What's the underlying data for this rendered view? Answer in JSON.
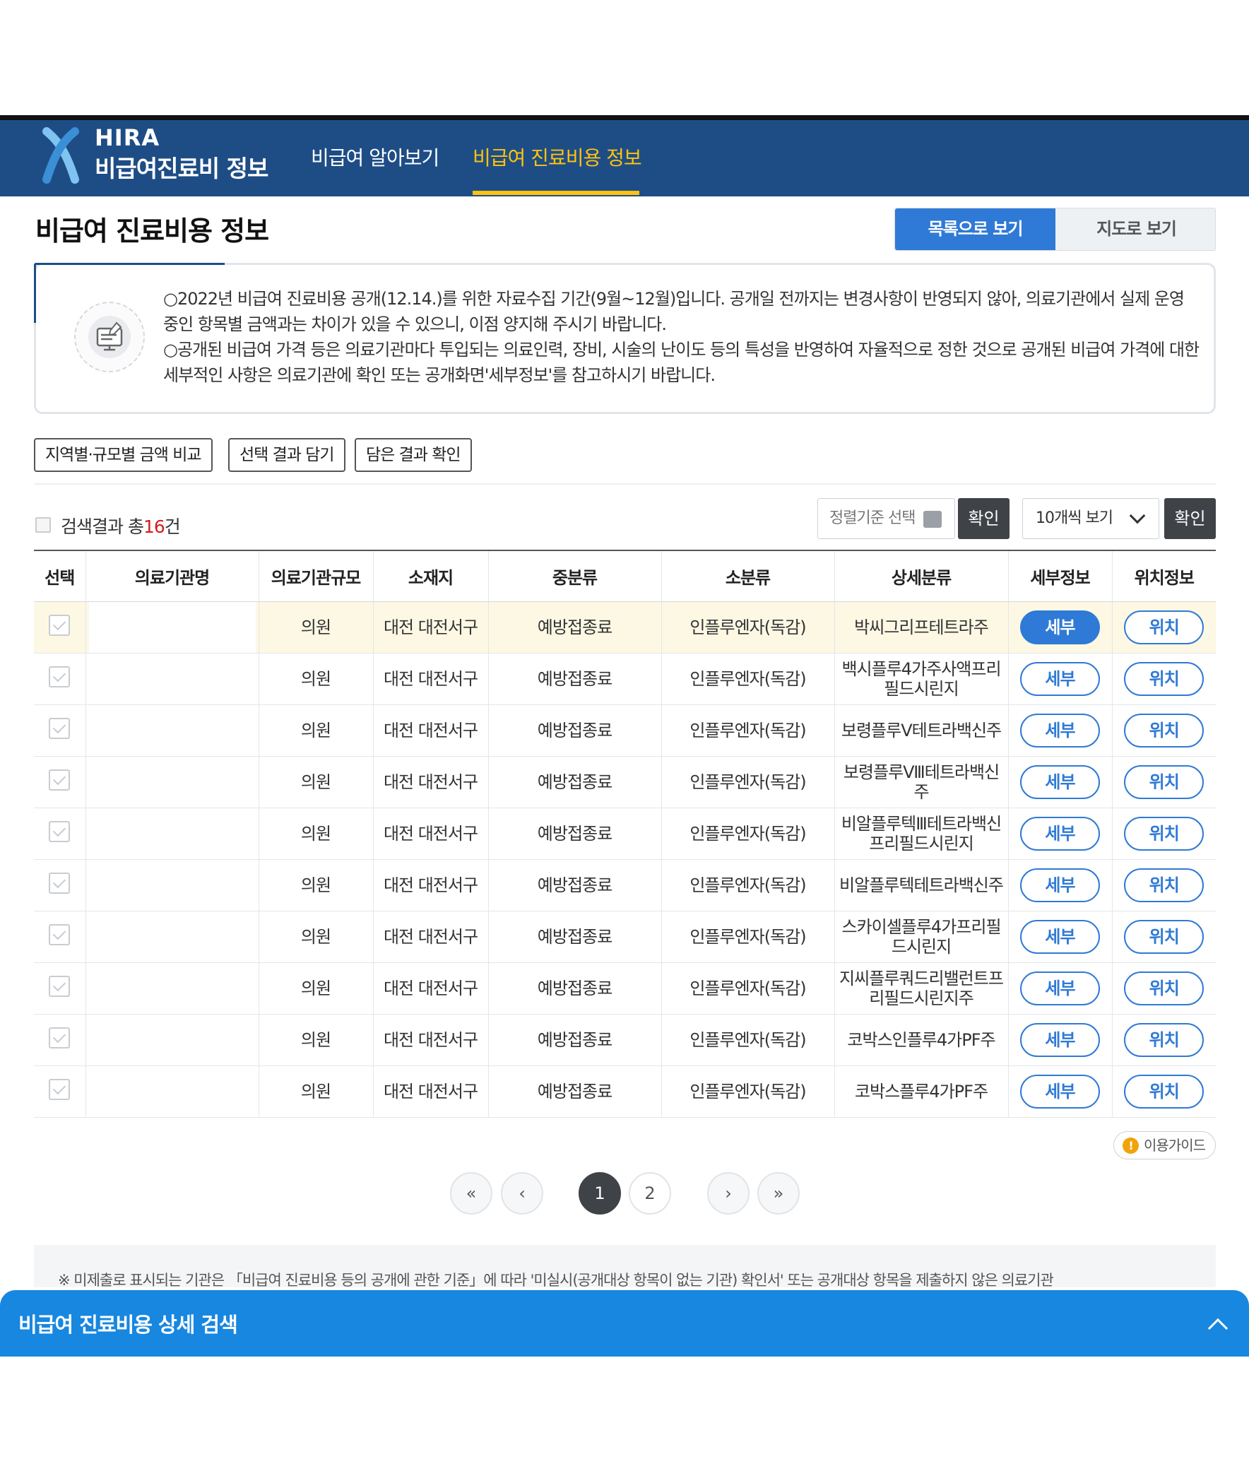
{
  "header": {
    "logo_en": "HIRA",
    "logo_ko": "비급여진료비 정보",
    "nav": [
      {
        "label": "비급여 알아보기",
        "active": false
      },
      {
        "label": "비급여 진료비용 정보",
        "active": true
      }
    ]
  },
  "page_title": "비급여 진료비용 정보",
  "view_toggle": {
    "list": "목록으로 보기",
    "map": "지도로 보기",
    "selected": "list"
  },
  "notice": {
    "icon": "notice-monitor-icon",
    "lines": [
      "○2022년 비급여 진료비용 공개(12.14.)를 위한 자료수집 기간(9월~12월)입니다. 공개일 전까지는 변경사항이 반영되지 않아, 의료기관에서 실제 운영 중인 항목별 금액과는 차이가 있을 수 있으니, 이점 양지해 주시기 바랍니다.",
      "○공개된 비급여 가격 등은 의료기관마다 투입되는 의료인력, 장비, 시술의 난이도 등의 특성을 반영하여 자율적으로 정한 것으로 공개된 비급여 가격에 대한 세부적인 사항은 의료기관에 확인 또는 공개화면'세부정보'를 참고하시기 바랍니다."
    ]
  },
  "tools": {
    "compare": "지역별·규모별 금액 비교",
    "add": "선택 결과 담기",
    "view": "담은 결과 확인"
  },
  "results": {
    "label_prefix": "검색결과 총",
    "count": "16",
    "label_suffix": "건"
  },
  "controls": {
    "sort_placeholder": "정렬기준 선택",
    "confirm": "확인",
    "per_page": "10개씩 보기"
  },
  "table": {
    "headers": [
      "선택",
      "의료기관명",
      "의료기관규모",
      "소재지",
      "중분류",
      "소분류",
      "상세분류",
      "세부정보",
      "위치정보"
    ],
    "detail_label": "세부",
    "location_label": "위치",
    "rows": [
      {
        "scale": "의원",
        "location": "대전 대전서구",
        "mid": "예방접종료",
        "sub": "인플루엔자(독감)",
        "detail": "박씨그리프테트라주",
        "highlighted": true
      },
      {
        "scale": "의원",
        "location": "대전 대전서구",
        "mid": "예방접종료",
        "sub": "인플루엔자(독감)",
        "detail": "백시플루4가주사액프리필드시린지",
        "highlighted": false
      },
      {
        "scale": "의원",
        "location": "대전 대전서구",
        "mid": "예방접종료",
        "sub": "인플루엔자(독감)",
        "detail": "보령플루Ⅴ테트라백신주",
        "highlighted": false
      },
      {
        "scale": "의원",
        "location": "대전 대전서구",
        "mid": "예방접종료",
        "sub": "인플루엔자(독감)",
        "detail": "보령플루Ⅷ테트라백신주",
        "highlighted": false
      },
      {
        "scale": "의원",
        "location": "대전 대전서구",
        "mid": "예방접종료",
        "sub": "인플루엔자(독감)",
        "detail": "비알플루텍Ⅲ테트라백신프리필드시린지",
        "highlighted": false
      },
      {
        "scale": "의원",
        "location": "대전 대전서구",
        "mid": "예방접종료",
        "sub": "인플루엔자(독감)",
        "detail": "비알플루텍테트라백신주",
        "highlighted": false
      },
      {
        "scale": "의원",
        "location": "대전 대전서구",
        "mid": "예방접종료",
        "sub": "인플루엔자(독감)",
        "detail": "스카이셀플루4가프리필드시린지",
        "highlighted": false
      },
      {
        "scale": "의원",
        "location": "대전 대전서구",
        "mid": "예방접종료",
        "sub": "인플루엔자(독감)",
        "detail": "지씨플루쿼드리밸런트프리필드시린지주",
        "highlighted": false
      },
      {
        "scale": "의원",
        "location": "대전 대전서구",
        "mid": "예방접종료",
        "sub": "인플루엔자(독감)",
        "detail": "코박스인플루4가PF주",
        "highlighted": false
      },
      {
        "scale": "의원",
        "location": "대전 대전서구",
        "mid": "예방접종료",
        "sub": "인플루엔자(독감)",
        "detail": "코박스플루4가PF주",
        "highlighted": false
      }
    ]
  },
  "guide": {
    "label": "이용가이드",
    "icon": "exclamation-icon"
  },
  "pagination": {
    "pages": [
      "1",
      "2"
    ],
    "current": "1",
    "first": "«",
    "prev": "‹",
    "next": "›",
    "last": "»"
  },
  "footer_note": "※ 미제출로 표시되는 기관은 「비급여 진료비용 등의 공개에 관한 기준」에 따라 '미실시(공개대상 항목이 없는 기관) 확인서' 또는 공개대상 항목을 제출하지 않은 의료기관",
  "bottom_bar": {
    "label": "비급여 진료비용 상세 검색",
    "icon": "chevron-up-icon"
  },
  "colors": {
    "header": "#1e4d86",
    "accent": "#ffc20e",
    "primary": "#2f7ad6",
    "count": "#d11e1e",
    "bottom_bar": "#1787e0"
  }
}
